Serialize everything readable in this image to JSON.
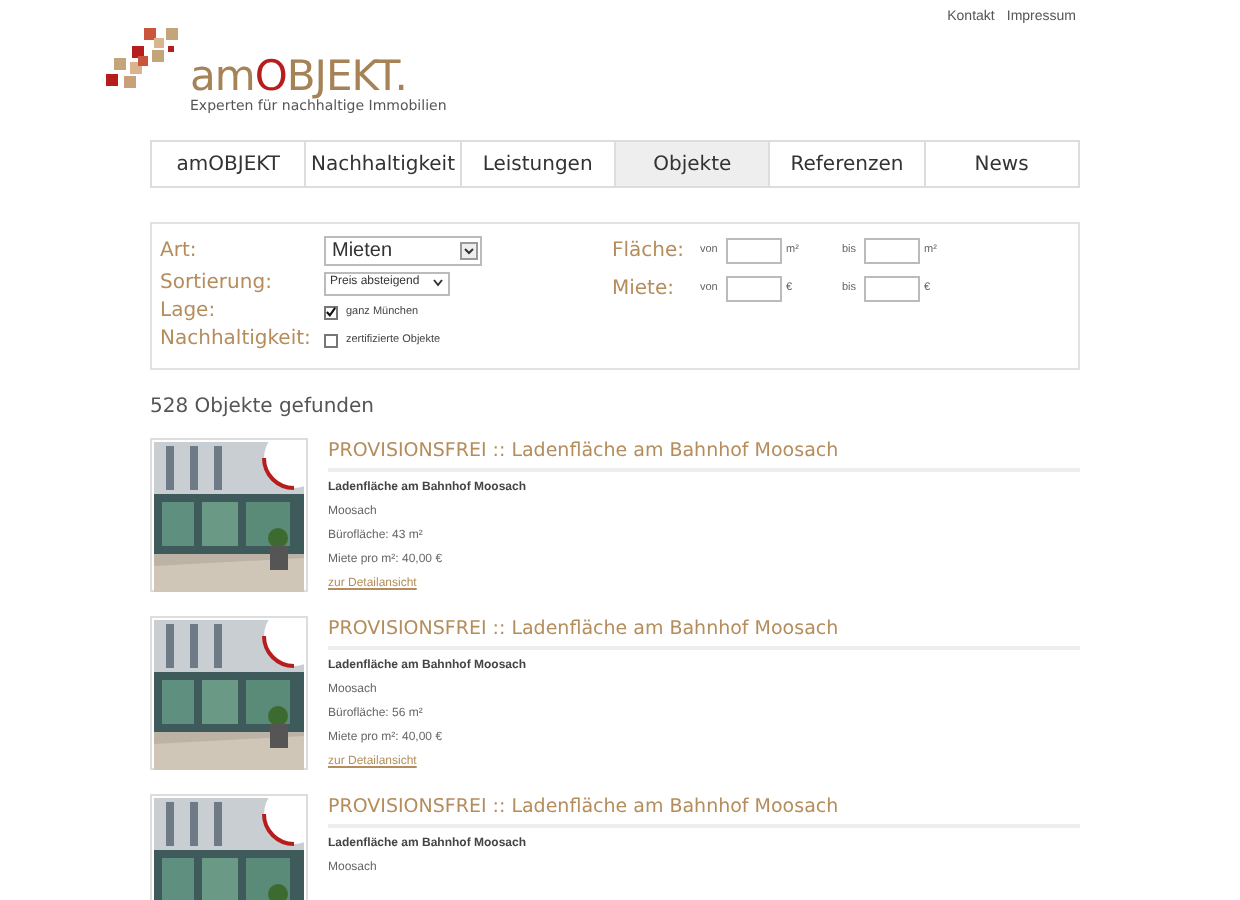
{
  "top_links": [
    "Kontakt",
    "Impressum"
  ],
  "logo": {
    "wordmark": "amOBJEKT.",
    "tagline": "Experten für nachhaltige Immobilien"
  },
  "nav": [
    {
      "label": "amOBJEKT",
      "selected": false
    },
    {
      "label": "Nachhaltigkeit",
      "selected": false
    },
    {
      "label": "Leistungen",
      "selected": false
    },
    {
      "label": "Objekte",
      "selected": true
    },
    {
      "label": "Referenzen",
      "selected": false
    },
    {
      "label": "News",
      "selected": false
    }
  ],
  "filters": {
    "art": {
      "label": "Art:",
      "value": "Mieten"
    },
    "sortierung": {
      "label": "Sortierung:",
      "value": "Preis absteigend"
    },
    "lage": {
      "label": "Lage:",
      "option": "ganz München",
      "checked": true
    },
    "nachhaltigkeit": {
      "label": "Nachhaltigkeit:",
      "option": "zertifizierte Objekte",
      "checked": false
    },
    "flaeche": {
      "label": "Fläche:",
      "from": "von",
      "to": "bis",
      "unit_from": "m²",
      "unit_to": "m²"
    },
    "miete": {
      "label": "Miete:",
      "from": "von",
      "to": "bis",
      "unit_from": "€",
      "unit_to": "€"
    }
  },
  "result_count": "528 Objekte gefunden",
  "listings": [
    {
      "title": "PROVISIONSFREI :: Ladenfläche am Bahnhof Moosach",
      "subtitle": "Ladenfläche am Bahnhof Moosach",
      "location": "Moosach",
      "area": "Bürofläche: 43 m²",
      "rent": "Miete pro m²: 40,00 €",
      "link": "zur Detailansicht"
    },
    {
      "title": "PROVISIONSFREI :: Ladenfläche am Bahnhof Moosach",
      "subtitle": "Ladenfläche am Bahnhof Moosach",
      "location": "Moosach",
      "area": "Bürofläche: 56 m²",
      "rent": "Miete pro m²: 40,00 €",
      "link": "zur Detailansicht"
    },
    {
      "title": "PROVISIONSFREI :: Ladenfläche am Bahnhof Moosach",
      "subtitle": "Ladenfläche am Bahnhof Moosach",
      "location": "Moosach"
    }
  ]
}
